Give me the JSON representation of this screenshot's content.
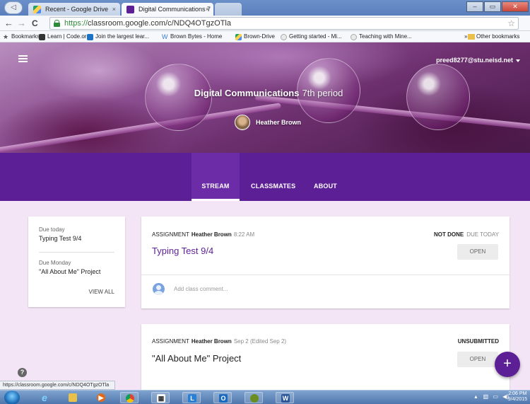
{
  "browser": {
    "tabs": [
      {
        "label": "Recent - Google Drive",
        "close": "×"
      },
      {
        "label": "Digital Communications 7",
        "close": "×"
      }
    ],
    "url_scheme": "https://",
    "url_rest": "classroom.google.com/c/NDQ4OTgzOTla",
    "bookmarks_label": "Bookmarks",
    "bookmarks": [
      "Learn | Code.org",
      "Join the largest lear...",
      "Brown Bytes - Home",
      "Brown-Drive",
      "Getting started - Mi...",
      "Teaching with Mine..."
    ],
    "other_bookmarks": "Other bookmarks",
    "status_url": "https://classroom.google.com/c/NDQ4OTgzOTla"
  },
  "header": {
    "account": "preed8277@stu.neisd.net",
    "class_name": "Digital Communications",
    "class_section": "7th period",
    "teacher": "Heather Brown"
  },
  "tabs": [
    {
      "label": "STREAM",
      "active": true
    },
    {
      "label": "CLASSMATES",
      "active": false
    },
    {
      "label": "ABOUT",
      "active": false
    }
  ],
  "upcoming": {
    "items": [
      {
        "when": "Due today",
        "title": "Typing Test 9/4"
      },
      {
        "when": "Due Monday",
        "title": "\"All About Me\" Project"
      }
    ],
    "view_all": "VIEW ALL"
  },
  "posts": [
    {
      "kind": "ASSIGNMENT",
      "author": "Heather Brown",
      "time": "8:22 AM",
      "status": "NOT DONE",
      "due": "DUE TODAY",
      "title": "Typing Test 9/4",
      "title_color": "#5d1f96",
      "open": "OPEN",
      "comment_placeholder": "Add class comment..."
    },
    {
      "kind": "ASSIGNMENT",
      "author": "Heather Brown",
      "time": "Sep 2 (Edited Sep 2)",
      "status": "UNSUBMITTED",
      "due": "",
      "title": "\"All About Me\" Project",
      "title_color": "#222222",
      "open": "OPEN"
    }
  ],
  "fab_label": "+",
  "help_label": "?",
  "taskbar": {
    "clock_time": "2:06 PM",
    "clock_date": "9/4/2015"
  },
  "colors": {
    "accent": "#5d1f96",
    "page_bg": "#f3e5f5"
  }
}
